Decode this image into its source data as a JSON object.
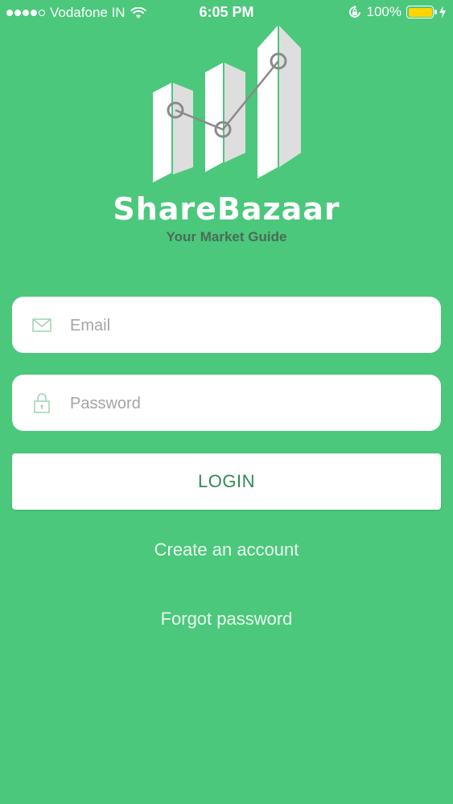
{
  "status_bar": {
    "carrier": "Vodafone IN",
    "time": "6:05 PM",
    "battery": "100%",
    "signal_strength": "4 of 5",
    "icons": [
      "signal-dots-icon",
      "wifi-icon",
      "rotation-lock-icon",
      "battery-icon",
      "charging-bolt-icon"
    ]
  },
  "brand": {
    "name": "ShareBazaar",
    "tagline": "Your Market Guide",
    "logo_icon": "bar-chart-trend-icon"
  },
  "form": {
    "email_placeholder": "Email",
    "email_value": "",
    "email_icon": "envelope-icon",
    "password_placeholder": "Password",
    "password_value": "",
    "password_icon": "lock-icon"
  },
  "actions": {
    "login_label": "LOGIN",
    "create_account_label": "Create an account",
    "forgot_password_label": "Forgot password"
  },
  "colors": {
    "background": "#4bc87c",
    "login_text": "#2f8a55",
    "tagline": "#4a6b57",
    "battery_fill": "#ffd400"
  }
}
